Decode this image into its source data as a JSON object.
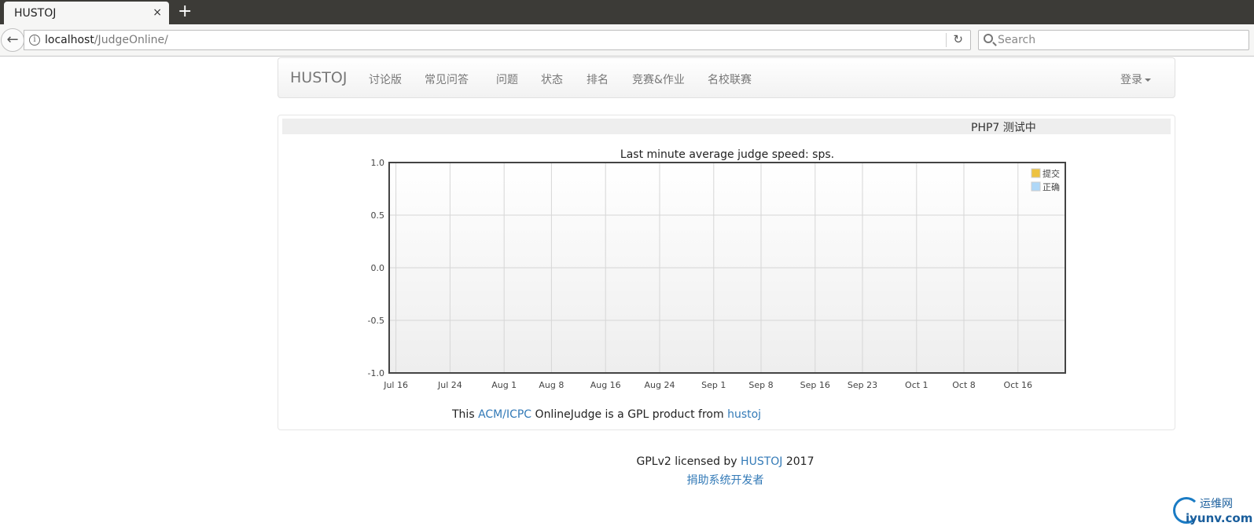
{
  "browser": {
    "tab_title": "HUSTOJ",
    "tab_close": "×",
    "new_tab": "+",
    "url_host": "localhost",
    "url_path": "/JudgeOnline/",
    "search_placeholder": "Search"
  },
  "nav": {
    "brand": "HUSTOJ",
    "items": [
      {
        "label": "讨论版"
      },
      {
        "label": "常见问答"
      },
      {
        "label": "问题"
      },
      {
        "label": "状态"
      },
      {
        "label": "排名"
      },
      {
        "label": "竞赛&作业"
      },
      {
        "label": "名校联赛"
      }
    ],
    "login": "登录"
  },
  "notice": "PHP7 测试中",
  "chart_data": {
    "type": "line",
    "title": "Last minute average judge speed: sps.",
    "xlabel": "",
    "ylabel": "",
    "ylim": [
      -1.0,
      1.0
    ],
    "yticks": [
      "1.0",
      "0.5",
      "0.0",
      "-0.5",
      "-1.0"
    ],
    "xticks": [
      "Jul 16",
      "Jul 24",
      "Aug 1",
      "Aug 8",
      "Aug 16",
      "Aug 24",
      "Sep 1",
      "Sep 8",
      "Sep 16",
      "Sep 23",
      "Oct 1",
      "Oct 8",
      "Oct 16"
    ],
    "xlim": [
      "Jul 15",
      "Oct 23"
    ],
    "grid": true,
    "legend_position": "top-right",
    "series": [
      {
        "name": "提交",
        "color": "#edc240",
        "values": []
      },
      {
        "name": "正确",
        "color": "#afd8f8",
        "values": []
      }
    ]
  },
  "gpl": {
    "prefix": "This ",
    "acm": "ACM/ICPC",
    "middle": " OnlineJudge is a GPL product from ",
    "hustoj": "hustoj"
  },
  "footer": {
    "prefix": "GPLv2 licensed by ",
    "link": "HUSTOJ",
    "year": " 2017",
    "donate": "捐助系统开发者"
  },
  "watermark": {
    "top": "运维网",
    "bottom": "iyunv.com"
  }
}
